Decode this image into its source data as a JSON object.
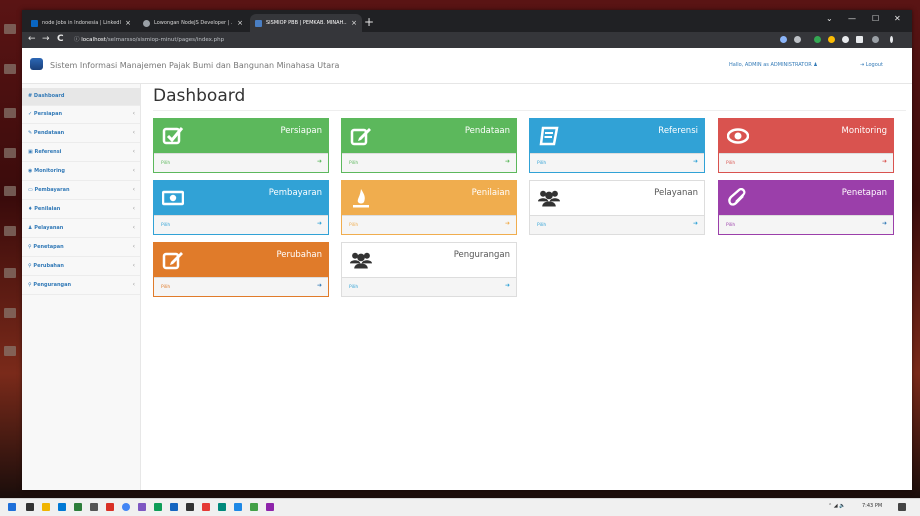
{
  "browser": {
    "tabs": [
      {
        "label": "node Jobs in Indonesia | LinkedIn",
        "favicon_color": "#0a66c2",
        "active": false
      },
      {
        "label": "Lowongan NodeJS Developer | ...",
        "favicon_color": "#9aa0a6",
        "active": false
      },
      {
        "label": "SISMIOP PBB | PEMKAB. MINAH...",
        "favicon_color": "#4a7fc4",
        "active": true
      }
    ],
    "new_tab": "+",
    "window_controls": [
      "⌄",
      "—",
      "☐",
      "✕"
    ],
    "nav": {
      "back": "←",
      "forward": "→",
      "reload": "C",
      "info": "ⓘ"
    },
    "address": {
      "host": "localhost",
      "path": "/selmarsso/sismiop-minut/pages/index.php"
    }
  },
  "app": {
    "title": "Sistem Informasi Manajemen Pajak Bumi dan Bangunan Minahasa Utara",
    "user_text": "Hallo, ADMIN as ADMINISTRATOR ♟",
    "logout_text": "⇥ Logout"
  },
  "sidebar": {
    "items": [
      {
        "label": "# Dashboard",
        "arrow": ""
      },
      {
        "label": "✓ Persiapan",
        "arrow": "‹"
      },
      {
        "label": "✎ Pendataan",
        "arrow": "‹"
      },
      {
        "label": "▣ Referensi",
        "arrow": "‹"
      },
      {
        "label": "◉ Monitoring",
        "arrow": "‹"
      },
      {
        "label": "▭ Pembayaran",
        "arrow": "‹"
      },
      {
        "label": "♦ Penilaian",
        "arrow": "‹"
      },
      {
        "label": "♟ Pelayanan",
        "arrow": "‹"
      },
      {
        "label": "⚲ Penetapan",
        "arrow": "‹"
      },
      {
        "label": "⚲ Perubahan",
        "arrow": "‹"
      },
      {
        "label": "⚲ Pengurangan",
        "arrow": "‹"
      }
    ]
  },
  "main": {
    "title": "Dashboard",
    "cards": [
      {
        "label": "Persiapan",
        "footer": "Pilih",
        "arrow": "➜",
        "icon": "check-square-icon",
        "color": "#5cb85c"
      },
      {
        "label": "Pendataan",
        "footer": "Pilih",
        "arrow": "➜",
        "icon": "edit-icon",
        "color": "#5cb85c"
      },
      {
        "label": "Referensi",
        "footer": "Pilih",
        "arrow": "➜",
        "icon": "book-icon",
        "color": "#31a2d6"
      },
      {
        "label": "Monitoring",
        "footer": "Pilih",
        "arrow": "➜",
        "icon": "eye-icon",
        "color": "#d9534f"
      },
      {
        "label": "Pembayaran",
        "footer": "Pilih",
        "arrow": "➜",
        "icon": "money-icon",
        "color": "#31a2d6"
      },
      {
        "label": "Penilaian",
        "footer": "Pilih",
        "arrow": "➜",
        "icon": "fire-icon",
        "color": "#f0ad4e"
      },
      {
        "label": "Pelayanan",
        "footer": "Pilih",
        "arrow": "➜",
        "icon": "users-icon",
        "color": "#ffffff"
      },
      {
        "label": "Penetapan",
        "footer": "Pilih",
        "arrow": "➜",
        "icon": "paperclip-icon",
        "color": "#9b3faa"
      },
      {
        "label": "Perubahan",
        "footer": "Pilih",
        "arrow": "➜",
        "icon": "edit-icon",
        "color": "#e07b2a"
      },
      {
        "label": "Pengurangan",
        "footer": "Pilih",
        "arrow": "➜",
        "icon": "users-icon",
        "color": "#ffffff"
      }
    ]
  },
  "taskbar": {
    "clock": "7:43 PM",
    "tray": "⌃ ◢ 🔈"
  }
}
